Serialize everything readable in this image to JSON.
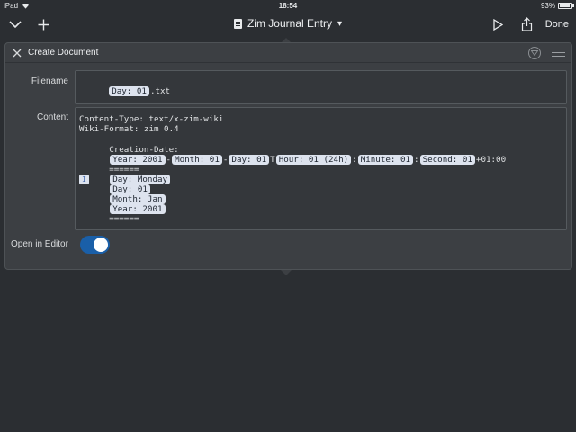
{
  "status_bar": {
    "device": "iPad",
    "time": "18:54",
    "battery": "93%"
  },
  "toolbar": {
    "title": "Zim Journal Entry",
    "title_caret": "▾",
    "done_label": "Done"
  },
  "panel": {
    "title": "Create Document",
    "filename_label": "Filename",
    "filename": {
      "token": "Day: 01",
      "suffix": ".txt"
    },
    "content_label": "Content",
    "content": {
      "line1": "Content-Type: text/x-zim-wiki",
      "line2": "Wiki-Format: zim 0.4",
      "line3_prefix": "Creation-Date:",
      "line3_tokens": [
        "Year: 2001",
        "Month: 01",
        "Day: 01",
        "Hour: 01 (24h)",
        "Minute: 01",
        "Second: 01"
      ],
      "line3_separators": [
        "-",
        "-",
        "T",
        ":",
        ":"
      ],
      "line3_suffix": "+01:00",
      "line4_prefix": "======",
      "line4_tokens": [
        "Day: Monday",
        "Day: 01",
        "Month: Jan",
        "Year: 2001"
      ],
      "line4_suffix": "======",
      "cursor_token": "I"
    },
    "open_in_editor_label": "Open in Editor",
    "open_in_editor": true
  },
  "colors": {
    "background": "#2b2e32",
    "panel": "#3c3f43",
    "token_bg": "#dde3ee",
    "toggle_on": "#1a5fa8"
  }
}
